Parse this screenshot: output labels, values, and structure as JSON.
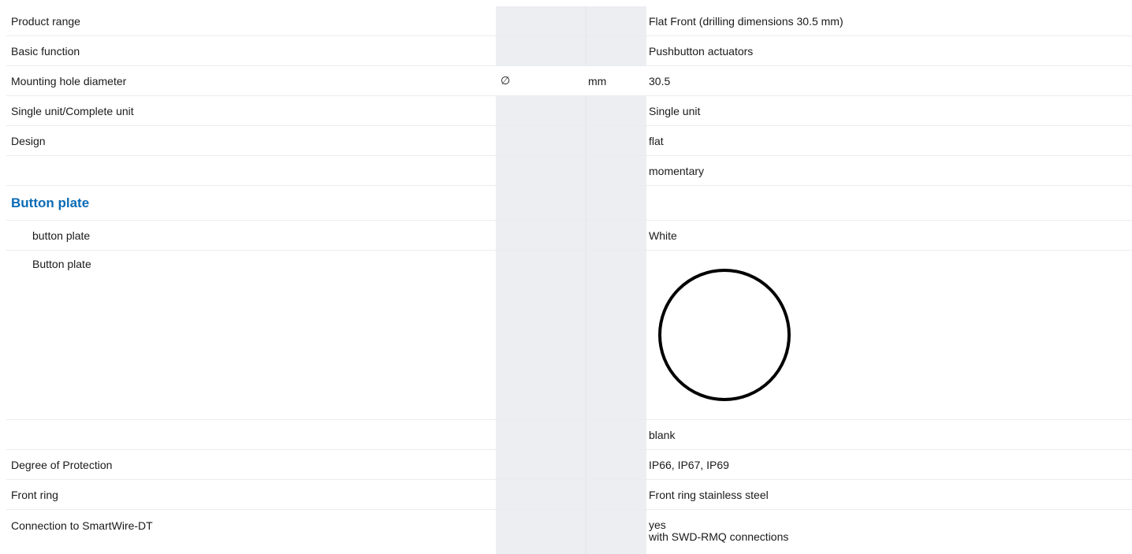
{
  "rows": [
    {
      "label": "Product range",
      "symbol": "",
      "unit": "",
      "value": "Flat Front (drilling dimensions 30.5 mm)"
    },
    {
      "label": "Basic function",
      "symbol": "",
      "unit": "",
      "value": "Pushbutton actuators"
    },
    {
      "label": "Mounting hole diameter",
      "symbol": "∅",
      "unit": "mm",
      "value": "30.5"
    },
    {
      "label": "Single unit/Complete unit",
      "symbol": "",
      "unit": "",
      "value": "Single unit"
    },
    {
      "label": "Design",
      "symbol": "",
      "unit": "",
      "value": "flat"
    },
    {
      "label": "",
      "symbol": "",
      "unit": "",
      "value": "momentary"
    }
  ],
  "section": {
    "title": "Button plate"
  },
  "button_plate_rows": [
    {
      "label": "button plate",
      "value": "White"
    },
    {
      "label": "Button plate",
      "image_icon": "circle-outline-icon"
    },
    {
      "label": "",
      "value": "blank"
    }
  ],
  "rows2": [
    {
      "label": "Degree of Protection",
      "value": "IP66, IP67, IP69"
    },
    {
      "label": "Front ring",
      "value": "Front ring stainless steel"
    },
    {
      "label": "Connection to SmartWire-DT",
      "value_lines": [
        "yes",
        "with SWD-RMQ connections"
      ]
    }
  ],
  "colors": {
    "heading_blue": "#0a6bb5",
    "shaded_column": "#eceef2",
    "row_border": "#e9ecef"
  }
}
